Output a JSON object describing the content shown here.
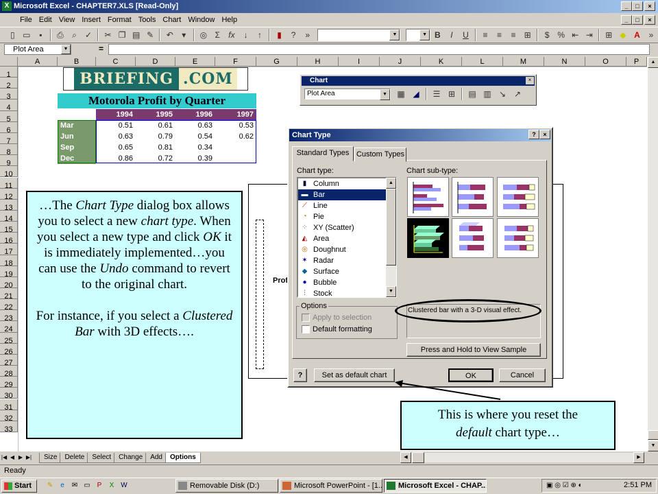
{
  "window": {
    "title": "Microsoft Excel - CHAPTER7.XLS  [Read-Only]"
  },
  "menu": [
    "File",
    "Edit",
    "View",
    "Insert",
    "Format",
    "Tools",
    "Chart",
    "Window",
    "Help"
  ],
  "formula_bar": {
    "name_box": "Plot Area",
    "equals": "="
  },
  "columns": [
    "A",
    "B",
    "C",
    "D",
    "E",
    "F",
    "G",
    "H",
    "I",
    "J",
    "K",
    "L",
    "M",
    "N",
    "O",
    "P"
  ],
  "rows": [
    "1",
    "2",
    "3",
    "4",
    "5",
    "6",
    "7",
    "8",
    "9",
    "10",
    "11",
    "12",
    "13",
    "14",
    "15",
    "16",
    "17",
    "18",
    "19",
    "20",
    "21",
    "22",
    "23",
    "24",
    "25",
    "26",
    "27",
    "28",
    "29",
    "30",
    "31",
    "32",
    "33"
  ],
  "sheet": {
    "logo_left": "BRIEFING",
    "logo_right": ".COM",
    "table_title": "Motorola Profit by Quarter",
    "years": [
      "1994",
      "1995",
      "1996",
      "1997"
    ],
    "quarters": [
      "Mar",
      "Jun",
      "Sep",
      "Dec"
    ],
    "values": [
      [
        "0.51",
        "0.61",
        "0.63",
        "0.53"
      ],
      [
        "0.63",
        "0.79",
        "0.54",
        "0.62"
      ],
      [
        "0.65",
        "0.81",
        "0.34",
        ""
      ],
      [
        "0.86",
        "0.72",
        "0.39",
        ""
      ]
    ],
    "chart_label": "Profi"
  },
  "chart_toolbar": {
    "title": "Chart",
    "object_combo": "Plot Area"
  },
  "dialog": {
    "title": "Chart Type",
    "tabs": [
      "Standard Types",
      "Custom Types"
    ],
    "chart_type_label": "Chart type:",
    "sub_type_label": "Chart sub-type:",
    "chart_types": [
      {
        "label": "Column",
        "icon": "column-chart-icon"
      },
      {
        "label": "Bar",
        "icon": "bar-chart-icon"
      },
      {
        "label": "Line",
        "icon": "line-chart-icon"
      },
      {
        "label": "Pie",
        "icon": "pie-chart-icon"
      },
      {
        "label": "XY (Scatter)",
        "icon": "scatter-chart-icon"
      },
      {
        "label": "Area",
        "icon": "area-chart-icon"
      },
      {
        "label": "Doughnut",
        "icon": "doughnut-chart-icon"
      },
      {
        "label": "Radar",
        "icon": "radar-chart-icon"
      },
      {
        "label": "Surface",
        "icon": "surface-chart-icon"
      },
      {
        "label": "Bubble",
        "icon": "bubble-chart-icon"
      },
      {
        "label": "Stock",
        "icon": "stock-chart-icon"
      }
    ],
    "selected_type": "Bar",
    "options_label": "Options",
    "apply_to_selection": "Apply to selection",
    "default_formatting": "Default formatting",
    "description": "Clustered bar with a 3-D visual effect.",
    "press_hold": "Press and Hold to View Sample",
    "set_default": "Set as default chart",
    "ok": "OK",
    "cancel": "Cancel",
    "help": "?"
  },
  "callouts": {
    "left_p1_a": "…The ",
    "left_p1_b": "Chart Type",
    "left_p1_c": " dialog box allows you to select a new ",
    "left_p1_d": "chart type",
    "left_p1_e": ".  When you select a new type and click ",
    "left_p1_f": "OK",
    "left_p1_g": " it is immediately implemented…you can use the ",
    "left_p1_h": "Undo",
    "left_p1_i": " command to revert to the original chart.",
    "left_p2_a": "For instance, if you select a ",
    "left_p2_b": "Clustered Bar",
    "left_p2_c": " with 3D effects….",
    "right_a": "This is where you reset the ",
    "right_b": "default",
    "right_c": " chart type…"
  },
  "sheet_tabs": [
    "Size",
    "Delete",
    "Select",
    "Change",
    "Add",
    "Options"
  ],
  "active_tab": "Options",
  "status": "Ready",
  "taskbar": {
    "start": "Start",
    "tasks": [
      "Removable Disk (D:)",
      "Microsoft PowerPoint - [1...",
      "Microsoft Excel - CHAP..."
    ],
    "clock": "2:51 PM"
  },
  "colors": {
    "title_teal": "#33cccc",
    "callout_bg": "#ccffff",
    "year_header": "#7a3a6b",
    "quarter_label": "#7a9a6b",
    "selection": "#0a246a"
  }
}
